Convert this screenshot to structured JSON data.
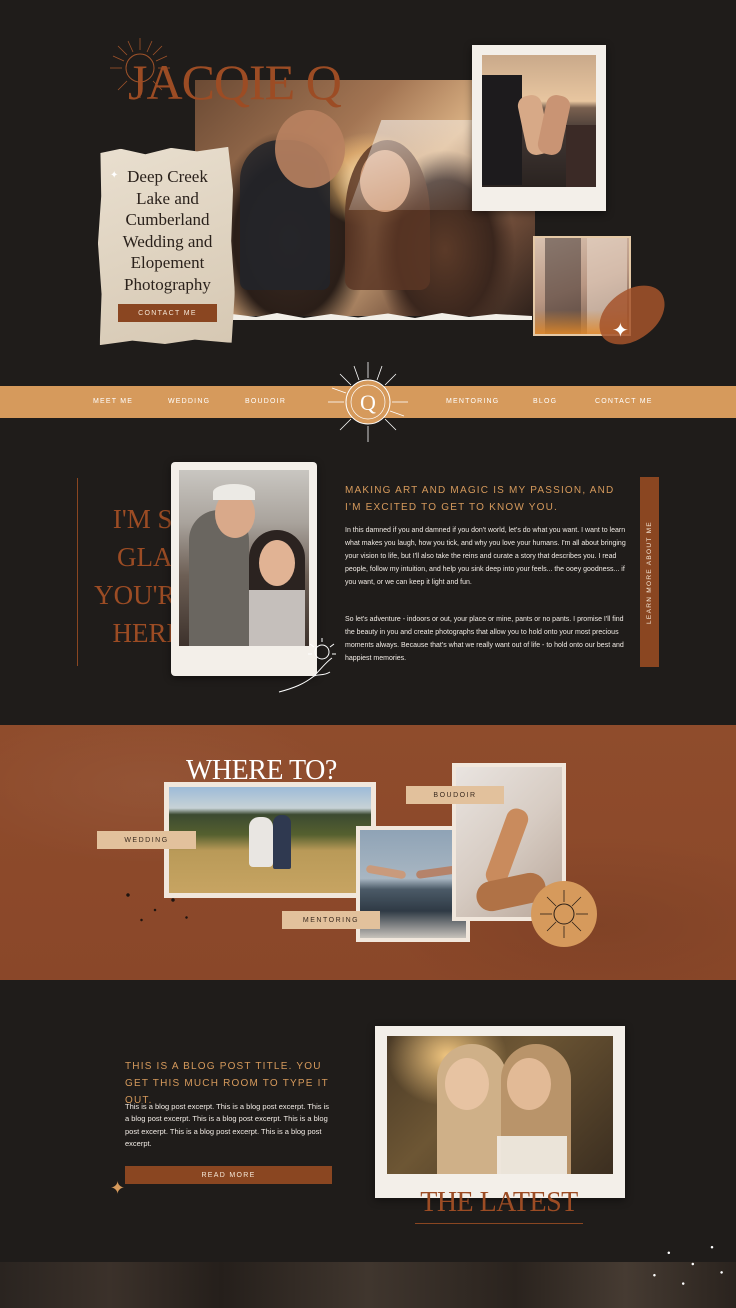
{
  "brand": {
    "logo_text": "JACQIE Q"
  },
  "hero": {
    "title": "Deep Creek Lake and Cumberland Wedding and Elopement Photography",
    "cta_label": "CONTACT ME"
  },
  "nav": {
    "items": [
      "MEET ME",
      "WEDDING",
      "BOUDOIR",
      "MENTORING",
      "BLOG",
      "CONTACT ME"
    ]
  },
  "about": {
    "big_heading_lines": [
      "I'M SO",
      "GLAD",
      "YOU'RE",
      "HERE!"
    ],
    "intro_heading": "MAKING ART AND MAGIC IS MY PASSION, AND I'M EXCITED TO GET TO KNOW YOU.",
    "paragraph1": "In this damned if you and damned if you don't world, let's do what you want. I want to learn what makes you laugh, how you tick, and why you love your humans. I'm all about bringing your vision to life, but I'll also take the reins and curate a story that describes you. I read people, follow my intuition, and help you sink deep into your feels... the ooey goodness... if you want, or we can keep it light and fun.",
    "paragraph2": "So let's adventure - indoors or out, your place or mine, pants or no pants. I promise I'll find the beauty in you and create photographs that allow you to hold onto your most precious moments always. Because that's what we really want out of life - to hold onto our best and happiest memories.",
    "side_button": "LEARN MORE ABOUT ME"
  },
  "where": {
    "heading": "WHERE TO?",
    "tags": {
      "boudoir": "BOUDOIR",
      "wedding": "WEDDING",
      "mentoring": "MENTORING"
    }
  },
  "blog": {
    "post_title": "THIS IS A BLOG POST TITLE. YOU GET THIS MUCH ROOM TO TYPE IT OUT.",
    "excerpt": "This is a blog post excerpt. This is a blog post excerpt. This is a blog post excerpt. This is a blog post excerpt. This is a blog post excerpt. This is a blog post excerpt. This is a blog post excerpt.",
    "read_more": "READ MORE",
    "section_title": "THE LATEST"
  },
  "colors": {
    "background": "#1f1c1a",
    "accent_rust": "#8a4621",
    "accent_tan": "#d69a5c",
    "brown_band": "#8e4a2b",
    "paper": "#e6dccd"
  },
  "icons": [
    "sun-logo-icon",
    "sparkle-icon",
    "hand-icon",
    "sun-badge-icon"
  ]
}
